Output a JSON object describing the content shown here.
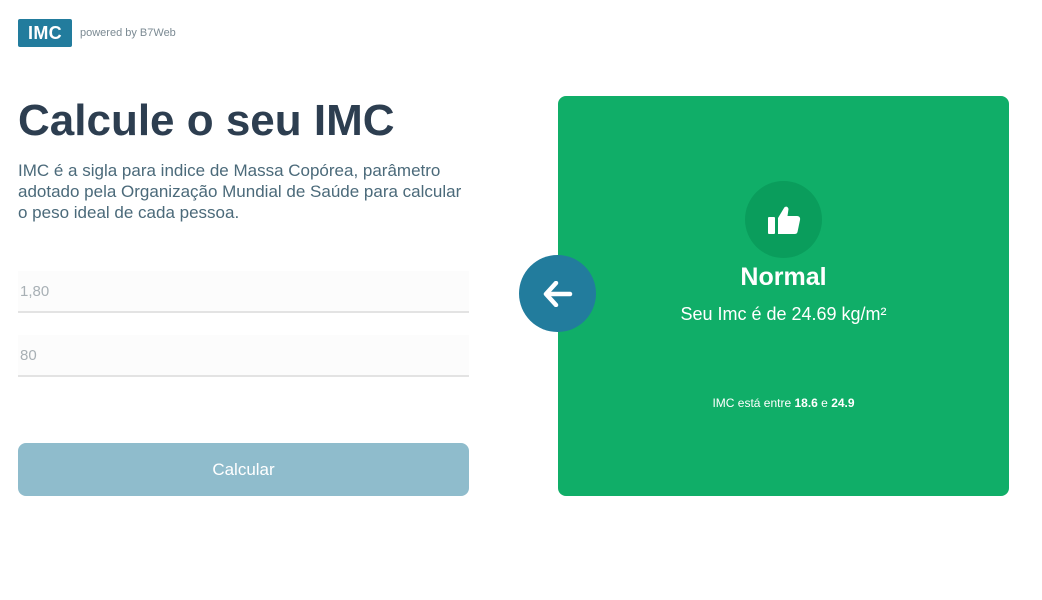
{
  "header": {
    "logo_text": "IMC",
    "powered_by": "powered by B7Web"
  },
  "main": {
    "title": "Calcule o seu IMC",
    "description": "IMC é a sigla para indice de Massa Copórea, parâmetro adotado pela Organização Mundial de Saúde para calcular o peso ideal de cada pessoa."
  },
  "form": {
    "height_placeholder": "1,80",
    "weight_placeholder": "80",
    "calculate_label": "Calcular"
  },
  "result": {
    "status": "Normal",
    "value_text": "Seu Imc é de 24.69 kg/m²",
    "range_prefix": "IMC está entre ",
    "range_min": "18.6",
    "range_joiner": " e ",
    "range_max": "24.9",
    "icon": "thumbs-up-icon",
    "color": "#10ae68"
  },
  "back_button": {
    "icon": "arrow-left-icon",
    "color": "#227c9d"
  }
}
